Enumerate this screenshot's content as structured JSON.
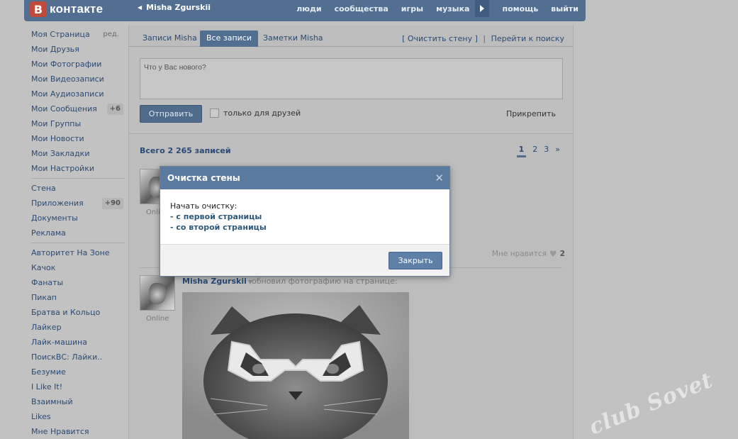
{
  "header": {
    "logo_badge": "B",
    "logo_text": "контакте",
    "user_name": "Misha Zgurskii",
    "nav": [
      "люди",
      "сообщества",
      "игры",
      "музыка",
      "помощь",
      "выйти"
    ]
  },
  "sidebar": {
    "edit_label": "ред.",
    "group1": [
      {
        "label": "Моя Страница"
      },
      {
        "label": "Мои Друзья"
      },
      {
        "label": "Мои Фотографии"
      },
      {
        "label": "Мои Видеозаписи"
      },
      {
        "label": "Мои Аудиозаписи"
      },
      {
        "label": "Мои Сообщения",
        "badge": "+6"
      },
      {
        "label": "Мои Группы"
      },
      {
        "label": "Мои Новости"
      },
      {
        "label": "Мои Закладки"
      },
      {
        "label": "Мои Настройки"
      }
    ],
    "group2": [
      {
        "label": "Стена"
      },
      {
        "label": "Приложения",
        "badge": "+90"
      },
      {
        "label": "Документы"
      },
      {
        "label": "Реклама"
      }
    ],
    "group3": [
      {
        "label": "Авторитет На Зоне"
      },
      {
        "label": "Качок"
      },
      {
        "label": "Фанаты"
      },
      {
        "label": "Пикап"
      },
      {
        "label": "Братва и Кольцо"
      },
      {
        "label": "Лайкер"
      },
      {
        "label": "Лайк-машина"
      },
      {
        "label": "ПоискВС: Лайки.."
      },
      {
        "label": "Безумие"
      },
      {
        "label": "I Like It!"
      },
      {
        "label": "Взаимный"
      },
      {
        "label": "Likes"
      },
      {
        "label": "Мне Нравится"
      }
    ]
  },
  "wall": {
    "tabs": [
      "Записи Misha",
      "Все записи",
      "Заметки Misha"
    ],
    "active_tab": "Все записи",
    "clear_link": "[ Очистить стену ]",
    "search_link": "Перейти к поиску",
    "separator": "|",
    "composer_placeholder": "Что у Вас нового?",
    "send_label": "Отправить",
    "friends_only_label": "только для друзей",
    "attach_label": "Прикрепить",
    "total_records": "Всего 2 265 записей",
    "pages": [
      "1",
      "2",
      "3",
      "»"
    ],
    "current_page": "1"
  },
  "posts": [
    {
      "status": "Online",
      "likes_label": "Мне нравится",
      "likes_count": "2"
    },
    {
      "author": "Misha Zgurskii",
      "action": "обновил фотографию на странице:",
      "status": "Online"
    }
  ],
  "modal": {
    "title": "Очистка стены",
    "close_glyph": "✕",
    "prompt": "Начать очистку:",
    "options": [
      "- с первой страницы",
      "- со второй страницы"
    ],
    "close_button": "Закрыть"
  },
  "watermark": "club Sovet",
  "colors": {
    "header_bg": "#526f92",
    "link": "#2a4a75",
    "modal_header": "#5b7aa0",
    "button": "#5e7fa6"
  }
}
